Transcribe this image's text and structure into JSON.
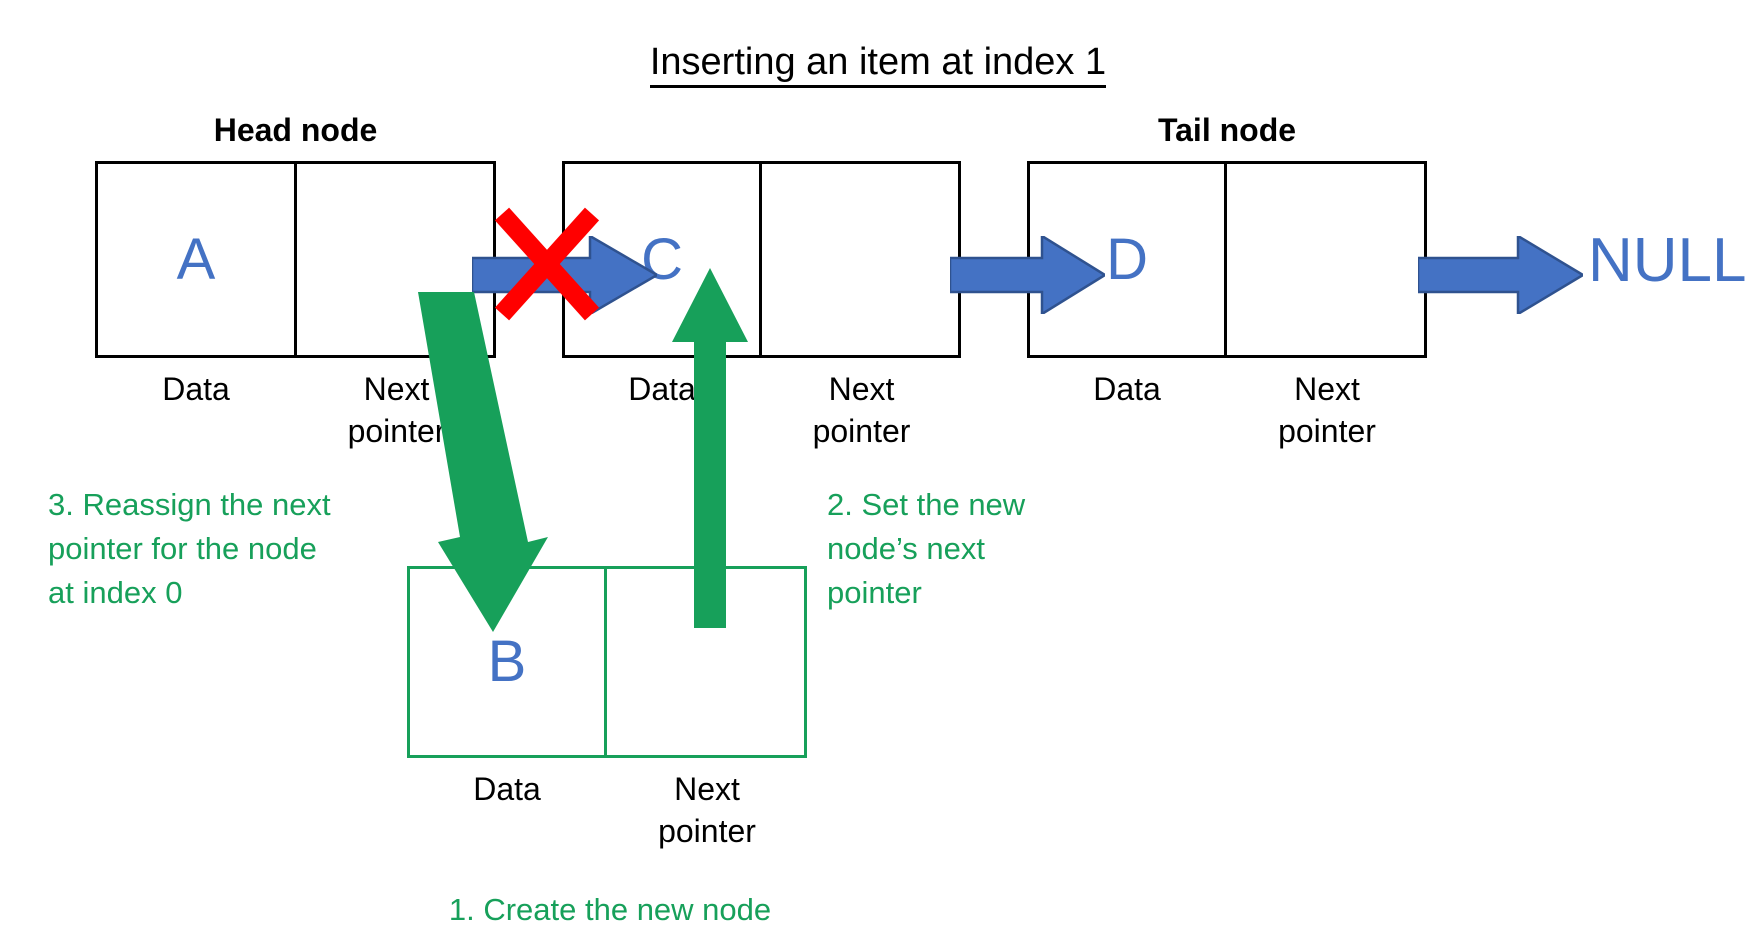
{
  "title": {
    "text": "Inserting an item at index 1"
  },
  "colors": {
    "node_value": "#4472c4",
    "blue_arrow": "#4472c4",
    "blue_arrow_outline": "#2f528f",
    "red_x": "#ff0000",
    "green": "#17a05a",
    "box_border": "#000000",
    "background": "#ffffff"
  },
  "labels": {
    "data": "Data",
    "next_pointer": "Next\npointer",
    "next_pointer_line1": "Next",
    "next_pointer_line2": "pointer",
    "null": "NULL"
  },
  "node_captions": {
    "head": "Head node",
    "tail": "Tail node"
  },
  "nodes": [
    {
      "id": "node-a",
      "caption": "Head node",
      "value": "A",
      "data_label": "Data",
      "next_label_line1": "Next",
      "next_label_line2": "pointer",
      "border_color": "#000000"
    },
    {
      "id": "node-c",
      "caption": "",
      "value": "C",
      "data_label": "Data",
      "next_label_line1": "Next",
      "next_label_line2": "pointer",
      "border_color": "#000000"
    },
    {
      "id": "node-d",
      "caption": "Tail node",
      "value": "D",
      "data_label": "Data",
      "next_label_line1": "Next",
      "next_label_line2": "pointer",
      "border_color": "#000000"
    },
    {
      "id": "node-b-new",
      "caption": "",
      "value": "B",
      "data_label": "Data",
      "next_label_line1": "Next",
      "next_label_line2": "pointer",
      "border_color": "#17a05a"
    }
  ],
  "annotations": [
    {
      "id": "step-3",
      "line1": "3. Reassign the next",
      "line2": "pointer for the node",
      "line3": "at index 0"
    },
    {
      "id": "step-2",
      "line1": "2. Set the new",
      "line2": "node’s next",
      "line3": "pointer"
    },
    {
      "id": "step-1",
      "line1": "1. Create the new node"
    }
  ],
  "markers": {
    "broken_link": "red-x-cross",
    "arrow_a_to_c": "blue-right-arrow",
    "arrow_c_to_d": "blue-right-arrow",
    "arrow_d_to_null": "blue-right-arrow",
    "arrow_a_to_b": "green-down-right-arrow",
    "arrow_b_to_c": "green-up-arrow"
  }
}
